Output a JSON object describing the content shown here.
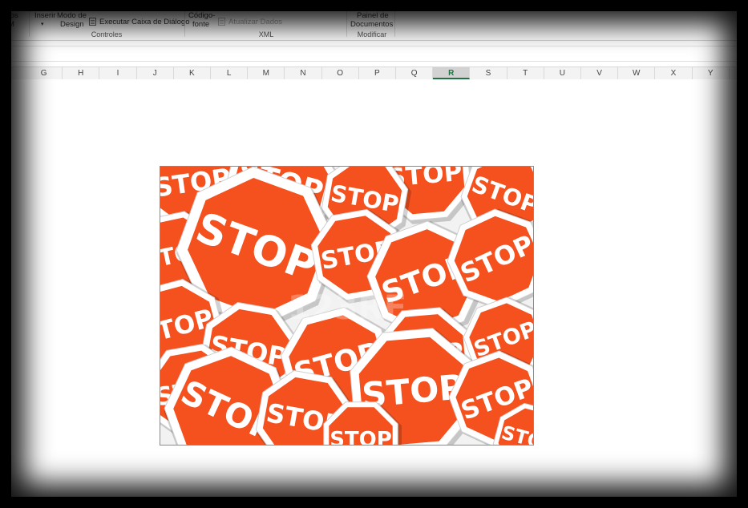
{
  "ribbon": {
    "insert_label": "Inserir",
    "design_mode_label_1": "Modo de",
    "design_mode_label_2": "Design",
    "run_dialog_label": "Executar Caixa de Diálogo",
    "controls_group_label": "Controles",
    "source_label_1": "Código-",
    "source_label_2": "fonte",
    "refresh_data_label": "Atualizar Dados",
    "xml_group_label": "XML",
    "doc_panel_label_1": "Painel de",
    "doc_panel_label_2": "Documentos",
    "modify_group_label": "Modificar",
    "partial_left_1": "itos",
    "partial_left_2": "M"
  },
  "columns": [
    "G",
    "H",
    "I",
    "J",
    "K",
    "L",
    "M",
    "N",
    "O",
    "P",
    "Q",
    "R",
    "S",
    "T",
    "U",
    "V",
    "W",
    "X",
    "Y"
  ],
  "selected_column": "R",
  "picture": {
    "sign_text": "STOP",
    "watermark": "123RF",
    "sign_color": "#f4511e",
    "border_color": "#ffffff"
  },
  "colors": {
    "excel_green": "#217346"
  }
}
